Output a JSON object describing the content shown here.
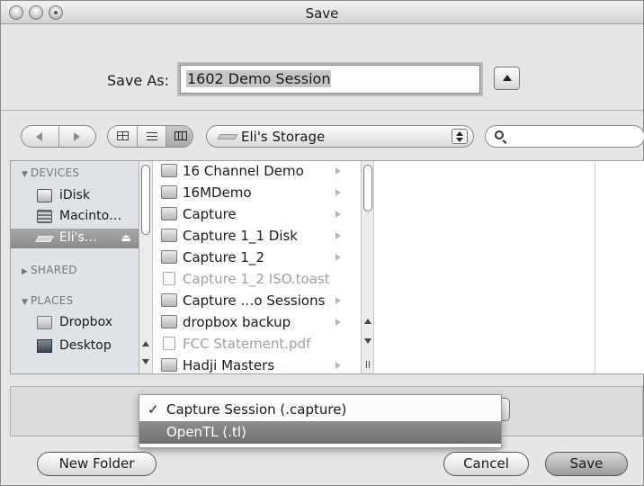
{
  "window": {
    "title": "Save"
  },
  "save_as": {
    "label": "Save As:",
    "value": "1602 Demo Session"
  },
  "location": {
    "label": "Eli's Storage",
    "search_placeholder": ""
  },
  "sidebar": {
    "sections": [
      {
        "label": "DEVICES",
        "expanded": true
      },
      {
        "label": "SHARED",
        "expanded": false
      },
      {
        "label": "PLACES",
        "expanded": true
      }
    ],
    "devices": [
      {
        "label": "iDisk",
        "icon": "idisk-icon",
        "selected": false
      },
      {
        "label": "Macinto…",
        "icon": "hard-disk-icon",
        "selected": false
      },
      {
        "label": "Eli's…",
        "icon": "external-drive-icon",
        "selected": true,
        "eject": "⏏"
      }
    ],
    "places": [
      {
        "label": "Dropbox",
        "icon": "folder-icon"
      },
      {
        "label": "Desktop",
        "icon": "desktop-icon"
      }
    ]
  },
  "files": [
    {
      "name": "16 Channel Demo",
      "kind": "folder",
      "enabled": true,
      "has_children": true
    },
    {
      "name": "16MDemo",
      "kind": "folder",
      "enabled": true,
      "has_children": true
    },
    {
      "name": "Capture",
      "kind": "folder",
      "enabled": true,
      "has_children": true
    },
    {
      "name": "Capture 1_1 Disk",
      "kind": "folder",
      "enabled": true,
      "has_children": true
    },
    {
      "name": "Capture 1_2",
      "kind": "folder",
      "enabled": true,
      "has_children": true
    },
    {
      "name": "Capture 1_2 ISO.toast",
      "kind": "document",
      "enabled": false,
      "has_children": false
    },
    {
      "name": "Capture …o Sessions",
      "kind": "folder",
      "enabled": true,
      "has_children": true
    },
    {
      "name": "dropbox backup",
      "kind": "folder",
      "enabled": true,
      "has_children": true
    },
    {
      "name": "FCC Statement.pdf",
      "kind": "pdf",
      "enabled": false,
      "has_children": false
    },
    {
      "name": "Hadji Masters",
      "kind": "folder",
      "enabled": true,
      "has_children": true
    }
  ],
  "format_menu": {
    "items": [
      {
        "label": "Capture Session (.capture)",
        "checked": true,
        "highlighted": false,
        "check_glyph": "✓"
      },
      {
        "label": "OpenTL (.tl)",
        "checked": false,
        "highlighted": true,
        "check_glyph": ""
      }
    ]
  },
  "buttons": {
    "new_folder": "New Folder",
    "cancel": "Cancel",
    "save": "Save"
  },
  "colors": {
    "selection_gray": "#8a8a8a",
    "sidebar_bg": "#dfe3e8",
    "window_bg": "#e6e6e6"
  }
}
